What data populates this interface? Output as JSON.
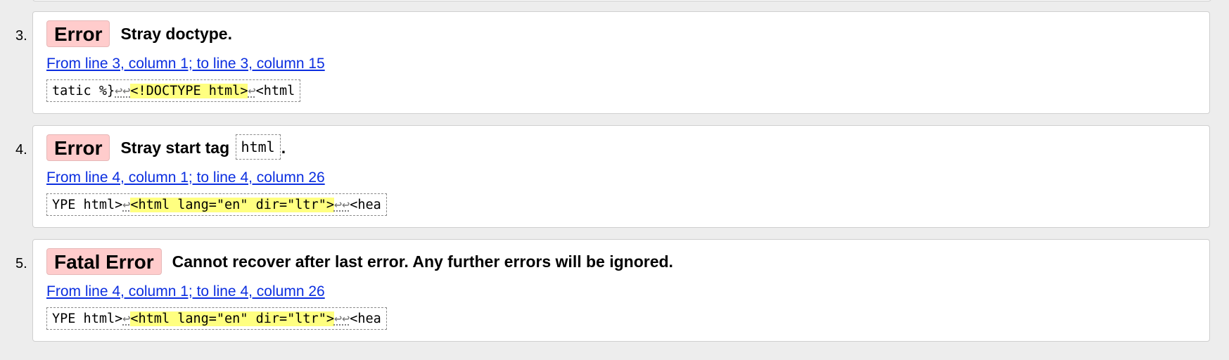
{
  "messages": [
    {
      "number": "3.",
      "type": "Error",
      "text_before": "Stray doctype.",
      "code": "",
      "text_after": "",
      "location": "From line 3, column 1; to line 3, column 15",
      "extract": {
        "before": "tatic %}",
        "lf_before": "↩↩",
        "highlight": "<!DOCTYPE html>",
        "lf_after": "↩",
        "after": "<html"
      }
    },
    {
      "number": "4.",
      "type": "Error",
      "text_before": "Stray start tag ",
      "code": "html",
      "text_after": ".",
      "location": "From line 4, column 1; to line 4, column 26",
      "extract": {
        "before": "YPE html>",
        "lf_before": "↩",
        "highlight": "<html lang=\"en\" dir=\"ltr\">",
        "lf_after": "↩↩",
        "after": "<hea"
      }
    },
    {
      "number": "5.",
      "type": "Fatal Error",
      "text_before": "Cannot recover after last error. Any further errors will be ignored.",
      "code": "",
      "text_after": "",
      "location": "From line 4, column 1; to line 4, column 26",
      "extract": {
        "before": "YPE html>",
        "lf_before": "↩",
        "highlight": "<html lang=\"en\" dir=\"ltr\">",
        "lf_after": "↩↩",
        "after": "<hea"
      }
    }
  ],
  "colors": {
    "badge_background": "#ffcccc",
    "highlight_background": "#ffff80",
    "link_color": "#0b2ee0",
    "page_background": "#ededed"
  }
}
